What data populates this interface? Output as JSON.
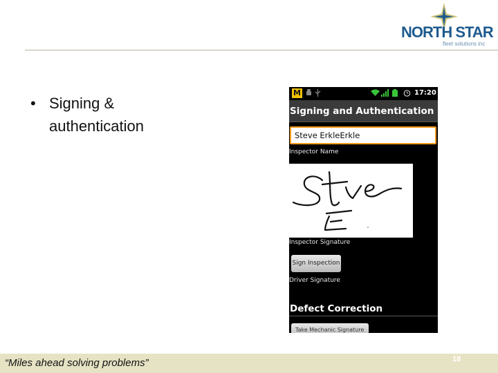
{
  "logo": {
    "wordmark": "NORTH STAR",
    "subtitle": "fleet solutions inc"
  },
  "slide": {
    "bullet_marker": "•",
    "bullet_text": "Signing & authentication"
  },
  "phone": {
    "status": {
      "time": "17:20",
      "app_badge": "M"
    },
    "screen_title": "Signing and Authentication",
    "inspector_name_value": "Steve ErkleErkle",
    "inspector_name_label": "Inspector Name",
    "inspector_signature_label": "Inspector Signature",
    "sign_inspection_button": "Sign Inspection",
    "driver_signature_label": "Driver Signature",
    "defect_section_title": "Defect Correction",
    "partial_button": "Take Mechanic Signature"
  },
  "footer": {
    "tagline": "“Miles ahead solving problems”",
    "page_number": "18"
  },
  "colors": {
    "brand_blue": "#1e5b8f",
    "footer_bg": "#e6e3c4",
    "input_focus": "#ff9a1a"
  }
}
